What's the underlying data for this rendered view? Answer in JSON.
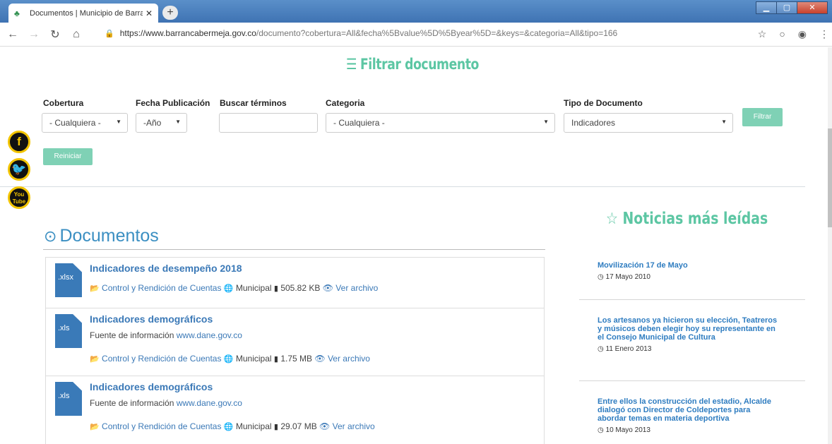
{
  "browser": {
    "tab_title": "Documentos | Municipio de Barra",
    "tab_close": "✕",
    "new_tab": "+",
    "url_host": "https://www.barrancabermeja.gov.co",
    "url_path": "/documento?cobertura=All&fecha%5Bvalue%5D%5Byear%5D=&keys=&categoria=All&tipo=166"
  },
  "filter": {
    "title": "Filtrar documento",
    "labels": {
      "cobertura": "Cobertura",
      "fecha": "Fecha Publicación",
      "buscar": "Buscar términos",
      "categoria": "Categoria",
      "tipo": "Tipo de Documento"
    },
    "values": {
      "cobertura": "- Cualquiera -",
      "fecha": "-Año",
      "buscar": "",
      "categoria": "- Cualquiera -",
      "tipo": "Indicadores"
    },
    "filtrar_button": "Filtrar",
    "reiniciar_button": "Reiniciar"
  },
  "social": {
    "facebook": "f",
    "twitter": "t",
    "youtube_top": "You",
    "youtube_bottom": "Tube"
  },
  "documents": {
    "title": "Documentos",
    "items": [
      {
        "ext": ".xlsx",
        "title": "Indicadores de desempeño 2018",
        "desc_prefix": "",
        "desc_link": "",
        "category": "Control y Rendición de Cuentas",
        "coverage": "Municipal",
        "size": "505.82 KB",
        "view": "Ver archivo"
      },
      {
        "ext": ".xls",
        "title": "Indicadores demográficos",
        "desc_prefix": "Fuente de información",
        "desc_link": "www.dane.gov.co",
        "category": "Control y Rendición de Cuentas",
        "coverage": "Municipal",
        "size": "1.75 MB",
        "view": "Ver archivo"
      },
      {
        "ext": ".xls",
        "title": "Indicadores demográficos",
        "desc_prefix": "Fuente de información",
        "desc_link": "www.dane.gov.co",
        "category": "Control y Rendición de Cuentas",
        "coverage": "Municipal",
        "size": "29.07 MB",
        "view": "Ver archivo"
      }
    ]
  },
  "news": {
    "title": "Noticias más leídas",
    "items": [
      {
        "title": "Movilización 17 de Mayo",
        "date": "17 Mayo 2010"
      },
      {
        "title": "Los artesanos ya hicieron su elección, Teatreros y músicos deben elegir hoy su representante en el Consejo Municipal de Cultura",
        "date": "11 Enero 2013"
      },
      {
        "title": "Entre ellos la construcción del estadio, Alcalde dialogó con Director de Coldeportes para abordar temas en materia deportiva",
        "date": "10 Mayo 2013"
      }
    ]
  }
}
